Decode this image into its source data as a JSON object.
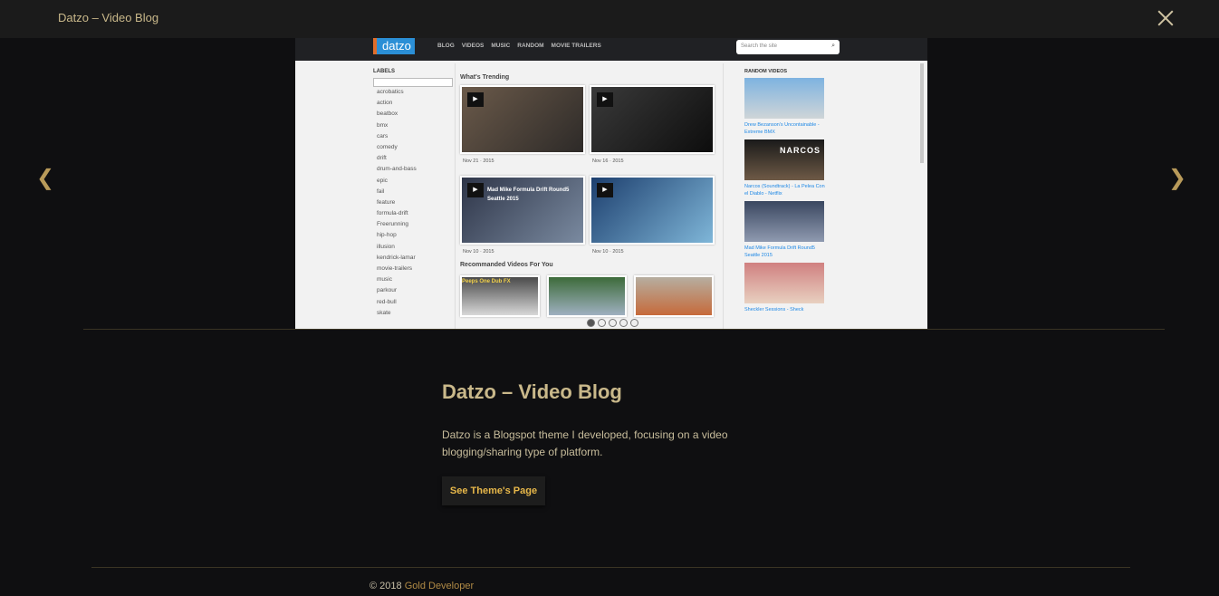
{
  "topbar": {
    "title": "Datzo – Video Blog"
  },
  "nav": {
    "prev": "❮",
    "next": "❯"
  },
  "screenshot": {
    "logo": "datzo",
    "links": [
      "BLOG",
      "VIDEOS",
      "MUSIC",
      "RANDOM",
      "MOVIE TRAILERS"
    ],
    "search_placeholder": "Search the site",
    "labels_heading": "LABELS",
    "labels": [
      "acrobatics",
      "action",
      "beatbox",
      "bmx",
      "cars",
      "comedy",
      "drift",
      "drum-and-bass",
      "epic",
      "fail",
      "feature",
      "formula-drift",
      "Freerunning",
      "hip-hop",
      "illusion",
      "kendrick-lamar",
      "movie-trailers",
      "music",
      "parkour",
      "red-bull",
      "skate"
    ],
    "trending_heading": "What's Trending",
    "trending": [
      {
        "date": "Nov 21 · 2015",
        "caption": "",
        "colors": [
          "#6b5a4a",
          "#2d2a28"
        ]
      },
      {
        "date": "Nov 16 · 2015",
        "caption": "",
        "colors": [
          "#3a3a3a",
          "#0d0d0d"
        ]
      },
      {
        "date": "Nov 10 · 2015",
        "caption": "Mad Mike Formula Drift Round5 Seattle 2015",
        "colors": [
          "#2e3548",
          "#7a8aa0"
        ]
      },
      {
        "date": "Nov 10 · 2015",
        "caption": "",
        "colors": [
          "#1d3f6e",
          "#7fb6d8"
        ]
      }
    ],
    "recommended_heading": "Recommanded Videos For You",
    "recommended": [
      {
        "caption": "Peeps One          Dub FX",
        "colors": [
          "#4a4a4a",
          "#d8d8d8"
        ]
      },
      {
        "caption": "",
        "colors": [
          "#3d6b3a",
          "#9fb0c0"
        ]
      },
      {
        "caption": "",
        "colors": [
          "#b6aea0",
          "#c66a3a"
        ]
      }
    ],
    "random_heading": "RANDOM VIDEOS",
    "random": [
      {
        "title": "Drew Bezanson's Uncontainable - Extreme BMX",
        "colors": [
          "#7eb3e0",
          "#cfd5d8"
        ],
        "overlay": ""
      },
      {
        "title": "Narcos (Soundtrack) - La Pelea Con el Diablo - Netflix",
        "colors": [
          "#1a1a1a",
          "#6e5a46"
        ],
        "overlay": "NARCOS"
      },
      {
        "title": "Mad Mike Formula Drift Round5 Seattle 2015",
        "colors": [
          "#3a4760",
          "#8f9ab0"
        ],
        "overlay": ""
      },
      {
        "title": "Sheckler Sessions - Sheck",
        "colors": [
          "#d08080",
          "#e8d0c0"
        ],
        "overlay": ""
      }
    ]
  },
  "info": {
    "heading": "Datzo – Video Blog",
    "description": "Datzo is a Blogspot theme I developed, focusing on a video blogging/sharing type of platform.",
    "button": "See Theme's Page"
  },
  "footer": {
    "copyright": "© 2018",
    "author": "Gold Developer"
  }
}
